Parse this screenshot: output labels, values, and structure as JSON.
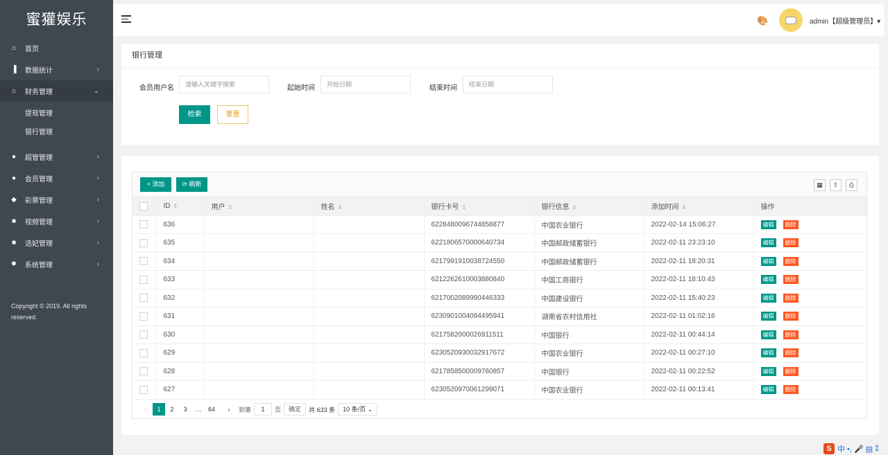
{
  "app": {
    "logo": "蜜獾娱乐"
  },
  "sidebar": {
    "items": [
      {
        "label": "首页",
        "icon": "home-icon",
        "glyph": "⌂",
        "arrow": ""
      },
      {
        "label": "数据统计",
        "icon": "bar-chart-icon",
        "glyph": "▐",
        "arrow": "›"
      },
      {
        "label": "财务管理",
        "icon": "bank-icon",
        "glyph": "⌂",
        "arrow": "⌄"
      },
      {
        "label": "超管管理",
        "icon": "user-icon",
        "glyph": "●",
        "arrow": "›"
      },
      {
        "label": "会员管理",
        "icon": "users-icon",
        "glyph": "●",
        "arrow": "›"
      },
      {
        "label": "彩票管理",
        "icon": "gamepad-icon",
        "glyph": "◆",
        "arrow": "›"
      },
      {
        "label": "视频管理",
        "icon": "video-icon",
        "glyph": "■",
        "arrow": "›"
      },
      {
        "label": "选妃管理",
        "icon": "video-icon",
        "glyph": "■",
        "arrow": "›"
      },
      {
        "label": "系统管理",
        "icon": "gear-icon",
        "glyph": "✹",
        "arrow": "›"
      }
    ],
    "sub_items": [
      "提现管理",
      "银行管理"
    ],
    "copyright": "Copyright © 2019. All rights reserved."
  },
  "header": {
    "user": "admin【超级管理员】▾",
    "palette_glyph": "🎨"
  },
  "search": {
    "title": "银行管理",
    "username_label": "会员用户名",
    "username_placeholder": "请输入关键字搜索",
    "start_label": "起始时间",
    "start_placeholder": "开始日期",
    "end_label": "结束时间",
    "end_placeholder": "结束日期",
    "search_button": "检索",
    "reset_button": "重置"
  },
  "toolbar": {
    "add": "+ 添加",
    "refresh": "⟳ 刷新"
  },
  "table": {
    "columns": [
      "ID",
      "用户",
      "姓名",
      "银行卡号",
      "银行信息",
      "添加时间",
      "操作"
    ],
    "edit_label": "编辑",
    "delete_label": "删除",
    "rows": [
      {
        "id": "636",
        "user": "",
        "name": "",
        "card": "6228480096744858877",
        "bank": "中国农业银行",
        "time": "2022-02-14 15:06:27"
      },
      {
        "id": "635",
        "user": "",
        "name": "",
        "card": "6221806570000640734",
        "bank": "中国邮政储蓄银行",
        "time": "2022-02-11 23:23:10"
      },
      {
        "id": "634",
        "user": "",
        "name": "",
        "card": "6217991910038724550",
        "bank": "中国邮政储蓄银行",
        "time": "2022-02-11 18:20:31"
      },
      {
        "id": "633",
        "user": "",
        "name": "",
        "card": "6212262610003880840",
        "bank": "中国工商银行",
        "time": "2022-02-11 18:10:43"
      },
      {
        "id": "632",
        "user": "",
        "name": "",
        "card": "6217002089990446333",
        "bank": "中国建设银行",
        "time": "2022-02-11 15:40:23"
      },
      {
        "id": "631",
        "user": "",
        "name": "",
        "card": "6230901004094495941",
        "bank": "湖南省农村信用社",
        "time": "2022-02-11 01:02:16"
      },
      {
        "id": "630",
        "user": "",
        "name": "",
        "card": "6217582000026911511",
        "bank": "中国银行",
        "time": "2022-02-11 00:44:14"
      },
      {
        "id": "629",
        "user": "",
        "name": "",
        "card": "6230520930032917672",
        "bank": "中国农业银行",
        "time": "2022-02-11 00:27:10"
      },
      {
        "id": "628",
        "user": "",
        "name": "",
        "card": "6217858500009760857",
        "bank": "中国银行",
        "time": "2022-02-11 00:22:52"
      },
      {
        "id": "627",
        "user": "",
        "name": "",
        "card": "6230520970061299071",
        "bank": "中国农业银行",
        "time": "2022-02-11 00:13:41"
      }
    ]
  },
  "pager": {
    "prev": "‹",
    "pages": [
      "1",
      "2",
      "3",
      "…",
      "64"
    ],
    "next": "›",
    "goto_label": "到第",
    "goto_value": "1",
    "page_unit": "页",
    "confirm": "确定",
    "total": "共 633 条",
    "page_size": "10 条/页 ⌄"
  },
  "ime": {
    "logo": "S",
    "text": "中 •, 🎤 ▤ ⁑"
  },
  "colors": {
    "accent": "#009688",
    "danger": "#ff5722",
    "sidebar": "#3f4751"
  }
}
